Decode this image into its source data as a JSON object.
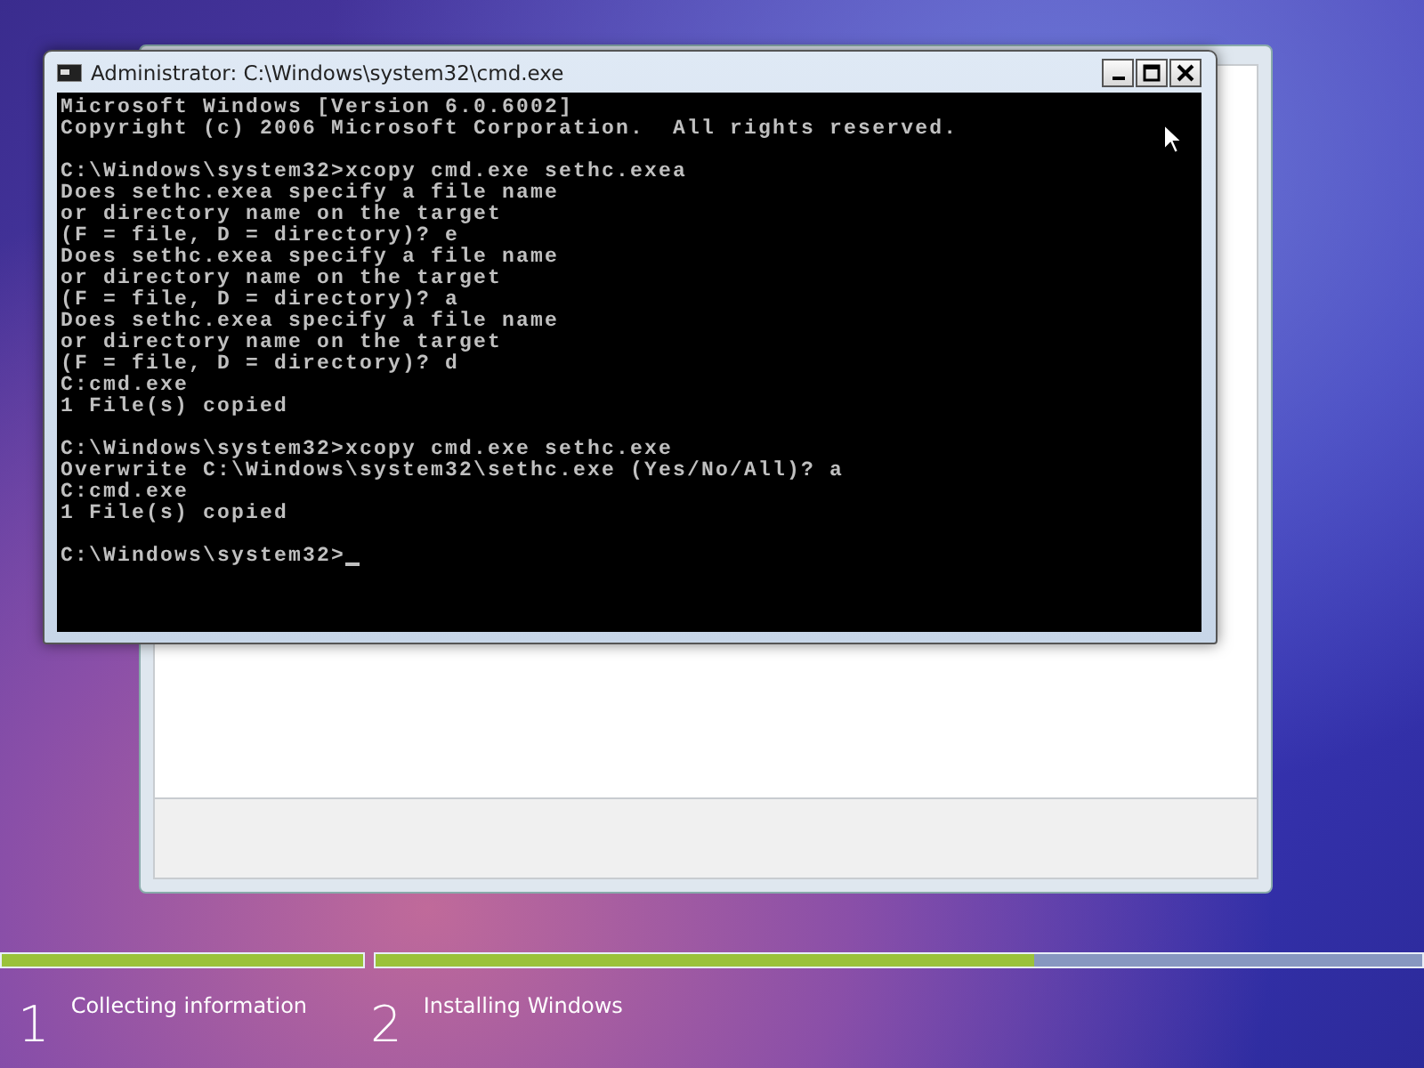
{
  "console_window": {
    "title": "Administrator: C:\\Windows\\system32\\cmd.exe",
    "blocks": [
      [
        "Microsoft Windows [Version 6.0.6002]",
        "Copyright (c) 2006 Microsoft Corporation.  All rights reserved."
      ],
      [
        "C:\\Windows\\system32>xcopy cmd.exe sethc.exea",
        "Does sethc.exea specify a file name",
        "or directory name on the target",
        "(F = file, D = directory)? e",
        "Does sethc.exea specify a file name",
        "or directory name on the target",
        "(F = file, D = directory)? a",
        "Does sethc.exea specify a file name",
        "or directory name on the target",
        "(F = file, D = directory)? d",
        "C:cmd.exe",
        "1 File(s) copied"
      ],
      [
        "C:\\Windows\\system32>xcopy cmd.exe sethc.exe",
        "Overwrite C:\\Windows\\system32\\sethc.exe (Yes/No/All)? a",
        "C:cmd.exe",
        "1 File(s) copied"
      ],
      [
        "C:\\Windows\\system32>"
      ]
    ]
  },
  "setup_steps": [
    {
      "number": "1",
      "label": "Collecting information",
      "level": 1
    },
    {
      "number": "2",
      "label": "Installing Windows",
      "level": 0.63
    }
  ]
}
